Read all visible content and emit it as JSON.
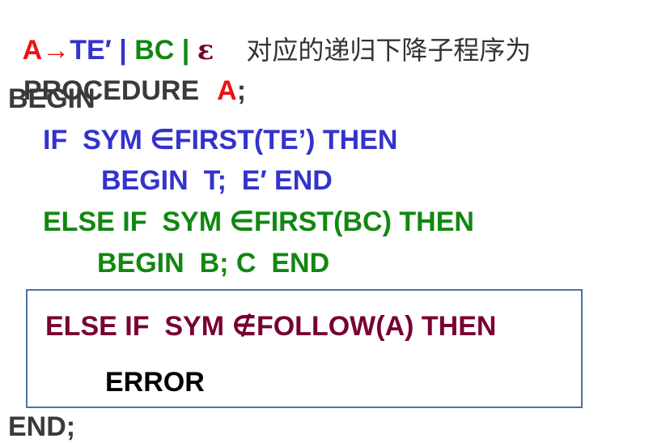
{
  "production": {
    "lhs": "A",
    "arrow": "→",
    "alt1": "TE′",
    "sep1": " | ",
    "alt2": "BC",
    "sep2": " | ",
    "alt3": "ε",
    "caption": "对应的递归下降子程序为"
  },
  "code": {
    "procedure_kw": "PROCEDURE",
    "procedure_name": "A",
    "procedure_end": ";",
    "begin": "BEGIN",
    "if_line": "IF  SYM ∈FIRST(TE’) THEN",
    "if_body": "BEGIN  T;  E′ END",
    "elseif_line": "ELSE IF  SYM ∈FIRST(BC) THEN",
    "elseif_body": "BEGIN  B; C  END",
    "boxed_line": "ELSE IF  SYM ∉FOLLOW(A) THEN",
    "boxed_body": "ERROR",
    "end": "END;"
  },
  "colors": {
    "lhs": "#ee1111",
    "alt1": "#3333cc",
    "alt2": "#118811",
    "alt3": "#770033",
    "box_border": "#4a72a8"
  }
}
